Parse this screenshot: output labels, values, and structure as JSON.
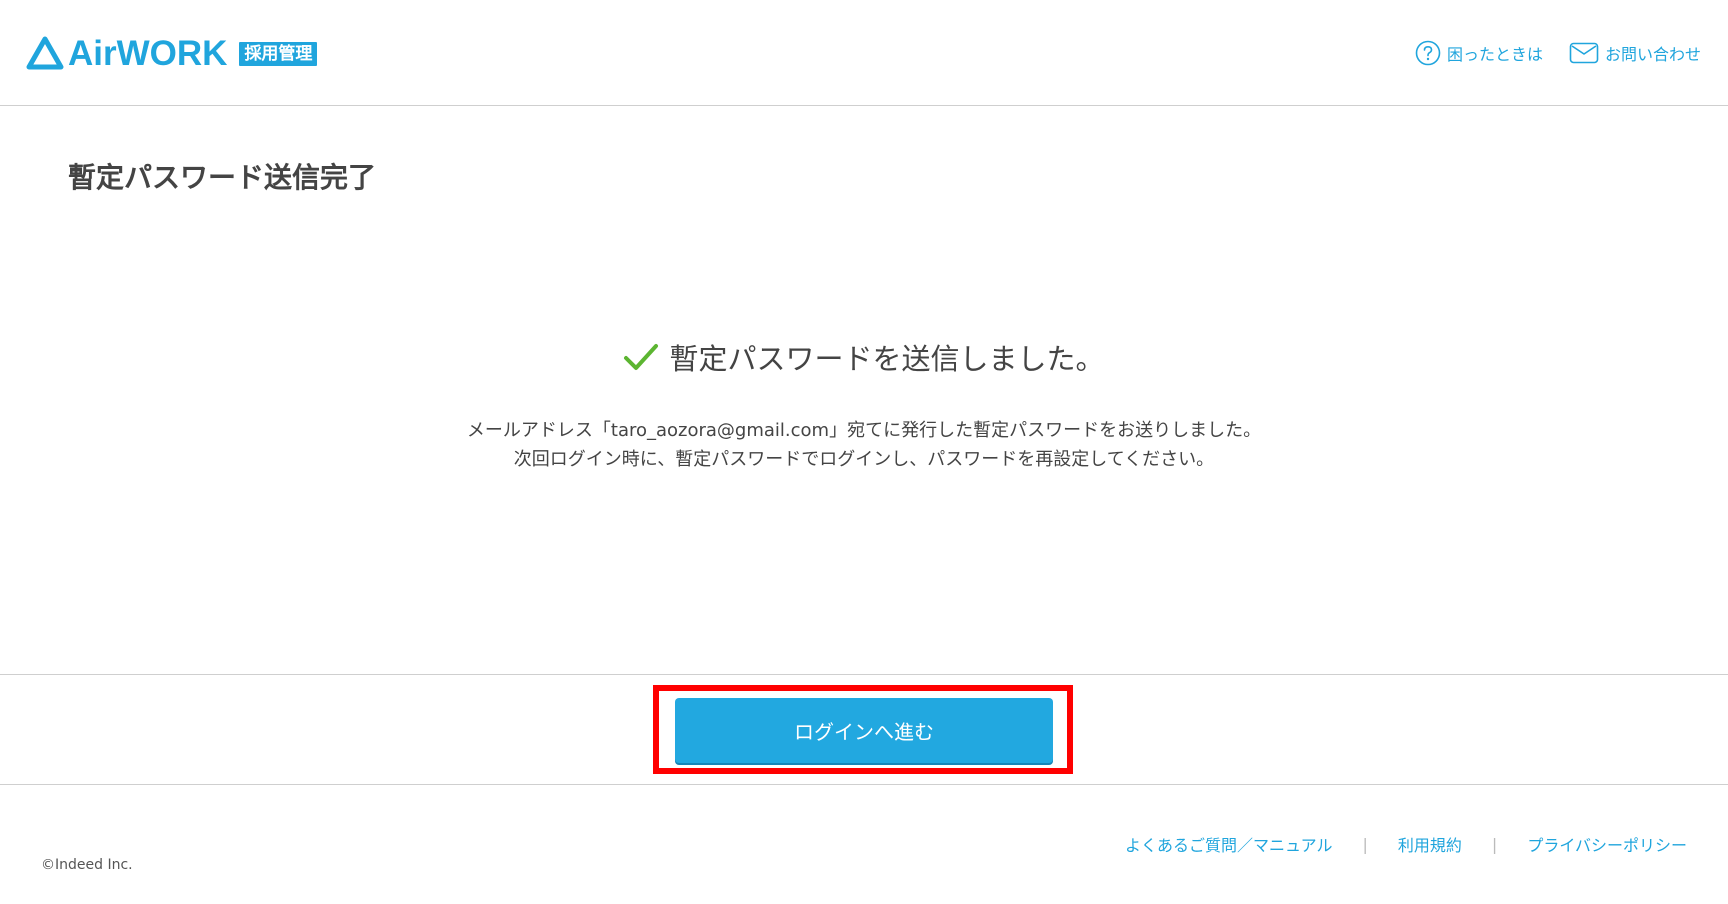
{
  "header": {
    "logo_text": "AirWORK",
    "logo_badge": "採用管理",
    "help_label": "困ったときは",
    "contact_label": "お問い合わせ"
  },
  "main": {
    "title": "暫定パスワード送信完了",
    "success_message": "暫定パスワードを送信しました。",
    "description_line1": "メールアドレス「taro_aozora@gmail.com」宛てに発行した暫定パスワードをお送りしました。",
    "description_line2": "次回ログイン時に、暫定パスワードでログインし、パスワードを再設定してください。"
  },
  "action": {
    "login_label": "ログインへ進む"
  },
  "footer": {
    "copyright": "©Indeed Inc.",
    "links": [
      "よくあるご質問／マニュアル",
      "利用規約",
      "プライバシーポリシー"
    ],
    "separator": "|"
  },
  "colors": {
    "accent": "#20a5dd",
    "button": "#22a8e0",
    "check": "#5cb531",
    "highlight": "#ff0000"
  }
}
